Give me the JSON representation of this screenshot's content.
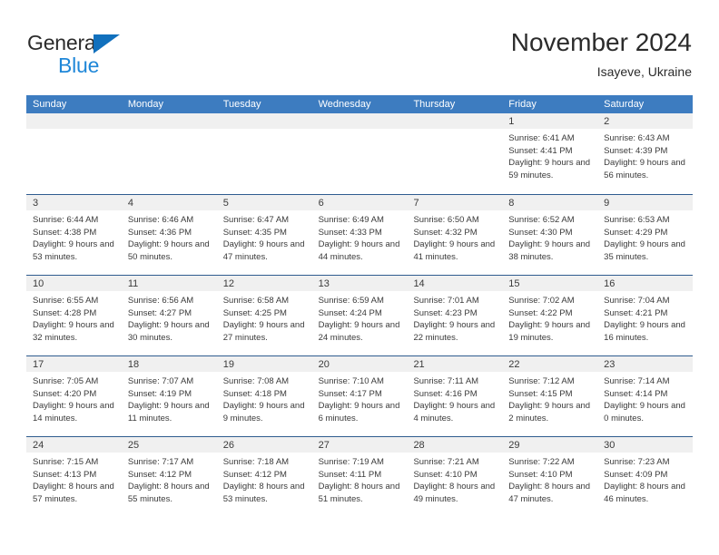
{
  "brand": {
    "name_dark": "General",
    "name_blue": "Blue",
    "accent_blue": "#1f87d8",
    "triangle_blue": "#1170bd"
  },
  "header": {
    "title": "November 2024",
    "subtitle": "Isayeve, Ukraine"
  },
  "theme": {
    "header_row_bg": "#3d7cc0",
    "week_divider": "#2f5c8f",
    "day_band_bg": "#f0f0f0",
    "text": "#3a3a3a"
  },
  "weekdays": [
    "Sunday",
    "Monday",
    "Tuesday",
    "Wednesday",
    "Thursday",
    "Friday",
    "Saturday"
  ],
  "weeks": [
    [
      {
        "day": "",
        "sunrise": "",
        "sunset": "",
        "daylight": ""
      },
      {
        "day": "",
        "sunrise": "",
        "sunset": "",
        "daylight": ""
      },
      {
        "day": "",
        "sunrise": "",
        "sunset": "",
        "daylight": ""
      },
      {
        "day": "",
        "sunrise": "",
        "sunset": "",
        "daylight": ""
      },
      {
        "day": "",
        "sunrise": "",
        "sunset": "",
        "daylight": ""
      },
      {
        "day": "1",
        "sunrise": "Sunrise: 6:41 AM",
        "sunset": "Sunset: 4:41 PM",
        "daylight": "Daylight: 9 hours and 59 minutes."
      },
      {
        "day": "2",
        "sunrise": "Sunrise: 6:43 AM",
        "sunset": "Sunset: 4:39 PM",
        "daylight": "Daylight: 9 hours and 56 minutes."
      }
    ],
    [
      {
        "day": "3",
        "sunrise": "Sunrise: 6:44 AM",
        "sunset": "Sunset: 4:38 PM",
        "daylight": "Daylight: 9 hours and 53 minutes."
      },
      {
        "day": "4",
        "sunrise": "Sunrise: 6:46 AM",
        "sunset": "Sunset: 4:36 PM",
        "daylight": "Daylight: 9 hours and 50 minutes."
      },
      {
        "day": "5",
        "sunrise": "Sunrise: 6:47 AM",
        "sunset": "Sunset: 4:35 PM",
        "daylight": "Daylight: 9 hours and 47 minutes."
      },
      {
        "day": "6",
        "sunrise": "Sunrise: 6:49 AM",
        "sunset": "Sunset: 4:33 PM",
        "daylight": "Daylight: 9 hours and 44 minutes."
      },
      {
        "day": "7",
        "sunrise": "Sunrise: 6:50 AM",
        "sunset": "Sunset: 4:32 PM",
        "daylight": "Daylight: 9 hours and 41 minutes."
      },
      {
        "day": "8",
        "sunrise": "Sunrise: 6:52 AM",
        "sunset": "Sunset: 4:30 PM",
        "daylight": "Daylight: 9 hours and 38 minutes."
      },
      {
        "day": "9",
        "sunrise": "Sunrise: 6:53 AM",
        "sunset": "Sunset: 4:29 PM",
        "daylight": "Daylight: 9 hours and 35 minutes."
      }
    ],
    [
      {
        "day": "10",
        "sunrise": "Sunrise: 6:55 AM",
        "sunset": "Sunset: 4:28 PM",
        "daylight": "Daylight: 9 hours and 32 minutes."
      },
      {
        "day": "11",
        "sunrise": "Sunrise: 6:56 AM",
        "sunset": "Sunset: 4:27 PM",
        "daylight": "Daylight: 9 hours and 30 minutes."
      },
      {
        "day": "12",
        "sunrise": "Sunrise: 6:58 AM",
        "sunset": "Sunset: 4:25 PM",
        "daylight": "Daylight: 9 hours and 27 minutes."
      },
      {
        "day": "13",
        "sunrise": "Sunrise: 6:59 AM",
        "sunset": "Sunset: 4:24 PM",
        "daylight": "Daylight: 9 hours and 24 minutes."
      },
      {
        "day": "14",
        "sunrise": "Sunrise: 7:01 AM",
        "sunset": "Sunset: 4:23 PM",
        "daylight": "Daylight: 9 hours and 22 minutes."
      },
      {
        "day": "15",
        "sunrise": "Sunrise: 7:02 AM",
        "sunset": "Sunset: 4:22 PM",
        "daylight": "Daylight: 9 hours and 19 minutes."
      },
      {
        "day": "16",
        "sunrise": "Sunrise: 7:04 AM",
        "sunset": "Sunset: 4:21 PM",
        "daylight": "Daylight: 9 hours and 16 minutes."
      }
    ],
    [
      {
        "day": "17",
        "sunrise": "Sunrise: 7:05 AM",
        "sunset": "Sunset: 4:20 PM",
        "daylight": "Daylight: 9 hours and 14 minutes."
      },
      {
        "day": "18",
        "sunrise": "Sunrise: 7:07 AM",
        "sunset": "Sunset: 4:19 PM",
        "daylight": "Daylight: 9 hours and 11 minutes."
      },
      {
        "day": "19",
        "sunrise": "Sunrise: 7:08 AM",
        "sunset": "Sunset: 4:18 PM",
        "daylight": "Daylight: 9 hours and 9 minutes."
      },
      {
        "day": "20",
        "sunrise": "Sunrise: 7:10 AM",
        "sunset": "Sunset: 4:17 PM",
        "daylight": "Daylight: 9 hours and 6 minutes."
      },
      {
        "day": "21",
        "sunrise": "Sunrise: 7:11 AM",
        "sunset": "Sunset: 4:16 PM",
        "daylight": "Daylight: 9 hours and 4 minutes."
      },
      {
        "day": "22",
        "sunrise": "Sunrise: 7:12 AM",
        "sunset": "Sunset: 4:15 PM",
        "daylight": "Daylight: 9 hours and 2 minutes."
      },
      {
        "day": "23",
        "sunrise": "Sunrise: 7:14 AM",
        "sunset": "Sunset: 4:14 PM",
        "daylight": "Daylight: 9 hours and 0 minutes."
      }
    ],
    [
      {
        "day": "24",
        "sunrise": "Sunrise: 7:15 AM",
        "sunset": "Sunset: 4:13 PM",
        "daylight": "Daylight: 8 hours and 57 minutes."
      },
      {
        "day": "25",
        "sunrise": "Sunrise: 7:17 AM",
        "sunset": "Sunset: 4:12 PM",
        "daylight": "Daylight: 8 hours and 55 minutes."
      },
      {
        "day": "26",
        "sunrise": "Sunrise: 7:18 AM",
        "sunset": "Sunset: 4:12 PM",
        "daylight": "Daylight: 8 hours and 53 minutes."
      },
      {
        "day": "27",
        "sunrise": "Sunrise: 7:19 AM",
        "sunset": "Sunset: 4:11 PM",
        "daylight": "Daylight: 8 hours and 51 minutes."
      },
      {
        "day": "28",
        "sunrise": "Sunrise: 7:21 AM",
        "sunset": "Sunset: 4:10 PM",
        "daylight": "Daylight: 8 hours and 49 minutes."
      },
      {
        "day": "29",
        "sunrise": "Sunrise: 7:22 AM",
        "sunset": "Sunset: 4:10 PM",
        "daylight": "Daylight: 8 hours and 47 minutes."
      },
      {
        "day": "30",
        "sunrise": "Sunrise: 7:23 AM",
        "sunset": "Sunset: 4:09 PM",
        "daylight": "Daylight: 8 hours and 46 minutes."
      }
    ]
  ]
}
